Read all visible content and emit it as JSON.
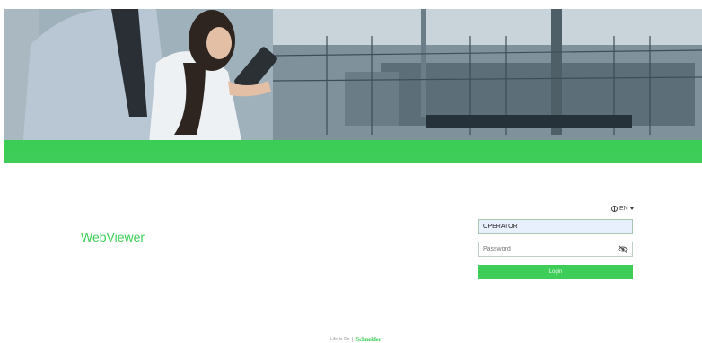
{
  "app": {
    "title": "WebViewer"
  },
  "language": {
    "selected": "EN"
  },
  "login": {
    "username_value": "OPERATOR",
    "password_placeholder": "Password",
    "submit_label": "Login"
  },
  "footer": {
    "tagline": "Life Is On",
    "brand": "Schneider"
  },
  "colors": {
    "brand_green": "#3dcd58"
  },
  "icons": {
    "language": "globe-icon",
    "password_toggle": "eye-slash-icon"
  }
}
